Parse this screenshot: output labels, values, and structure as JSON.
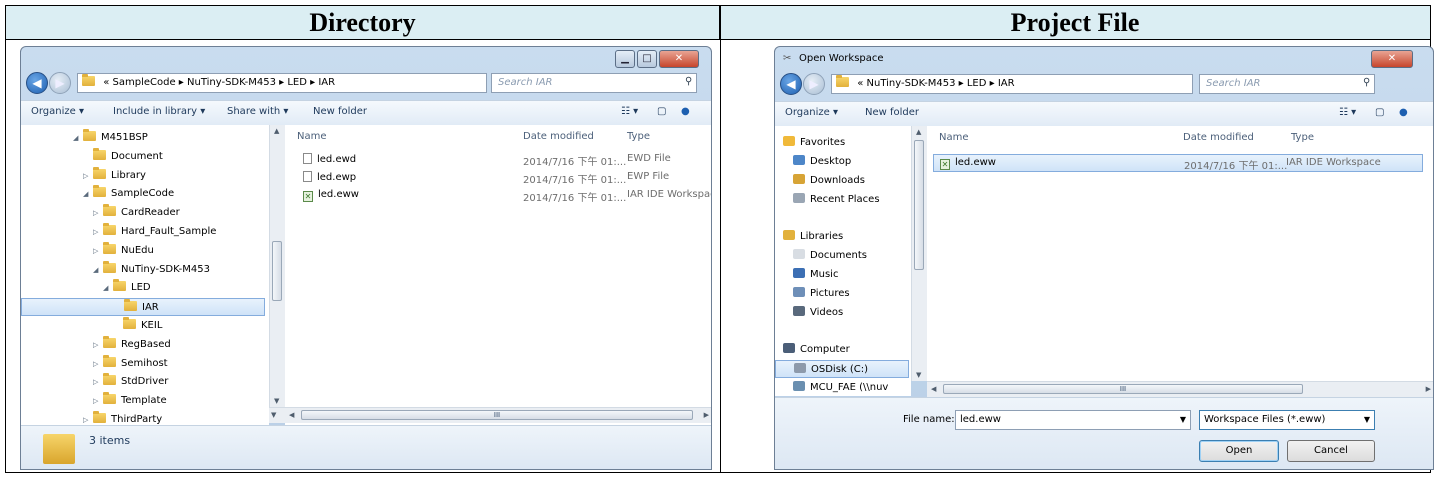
{
  "headers": {
    "left": "Directory",
    "right": "Project File"
  },
  "explorer": {
    "breadcrumb": [
      "«",
      "SampleCode",
      "NuTiny-SDK-M453",
      "LED",
      "IAR"
    ],
    "search_placeholder": "Search IAR",
    "toolbar": {
      "organize": "Organize ▾",
      "include": "Include in library ▾",
      "share": "Share with ▾",
      "new_folder": "New folder"
    },
    "tree": [
      {
        "label": "M451BSP",
        "indent": 0,
        "expander": "◢"
      },
      {
        "label": "Document",
        "indent": 1,
        "expander": ""
      },
      {
        "label": "Library",
        "indent": 1,
        "expander": "▷"
      },
      {
        "label": "SampleCode",
        "indent": 1,
        "expander": "◢"
      },
      {
        "label": "CardReader",
        "indent": 2,
        "expander": "▷"
      },
      {
        "label": "Hard_Fault_Sample",
        "indent": 2,
        "expander": "▷"
      },
      {
        "label": "NuEdu",
        "indent": 2,
        "expander": "▷"
      },
      {
        "label": "NuTiny-SDK-M453",
        "indent": 2,
        "expander": "◢"
      },
      {
        "label": "LED",
        "indent": 3,
        "expander": "◢"
      },
      {
        "label": "IAR",
        "indent": 4,
        "expander": ""
      },
      {
        "label": "KEIL",
        "indent": 4,
        "expander": ""
      },
      {
        "label": "RegBased",
        "indent": 2,
        "expander": "▷"
      },
      {
        "label": "Semihost",
        "indent": 2,
        "expander": "▷"
      },
      {
        "label": "StdDriver",
        "indent": 2,
        "expander": "▷"
      },
      {
        "label": "Template",
        "indent": 2,
        "expander": "▷"
      },
      {
        "label": "ThirdParty",
        "indent": 1,
        "expander": "▷"
      }
    ],
    "columns": {
      "name": "Name",
      "date": "Date modified",
      "type": "Type"
    },
    "files": [
      {
        "name": "led.ewd",
        "date": "2014/7/16 下午 01:...",
        "type": "EWD File",
        "icon": "file-icon"
      },
      {
        "name": "led.ewp",
        "date": "2014/7/16 下午 01:...",
        "type": "EWP File",
        "icon": "file-icon"
      },
      {
        "name": "led.eww",
        "date": "2014/7/16 下午 01:...",
        "type": "IAR IDE Workspace",
        "icon": "workspace-icon"
      }
    ],
    "status_text": "3 items",
    "scroll_arrow_h": "III"
  },
  "dialog": {
    "title": "Open Workspace",
    "breadcrumb": [
      "«",
      "NuTiny-SDK-M453",
      "LED",
      "IAR"
    ],
    "search_placeholder": "Search IAR",
    "toolbar": {
      "organize": "Organize ▾",
      "new_folder": "New folder"
    },
    "nav": [
      {
        "label": "Favorites",
        "icon": "star-icon",
        "group": true
      },
      {
        "label": "Desktop",
        "icon": "desktop-icon"
      },
      {
        "label": "Downloads",
        "icon": "downloads-icon"
      },
      {
        "label": "Recent Places",
        "icon": "recent-places-icon"
      },
      {
        "label": "Libraries",
        "icon": "libraries-icon",
        "group": true
      },
      {
        "label": "Documents",
        "icon": "documents-icon"
      },
      {
        "label": "Music",
        "icon": "music-icon"
      },
      {
        "label": "Pictures",
        "icon": "pictures-icon"
      },
      {
        "label": "Videos",
        "icon": "videos-icon"
      },
      {
        "label": "Computer",
        "icon": "computer-icon",
        "group": true
      },
      {
        "label": "OSDisk (C:)",
        "icon": "disk-icon"
      },
      {
        "label": "MCU_FAE (\\\\nuv",
        "icon": "network-drive-icon"
      }
    ],
    "columns": {
      "name": "Name",
      "date": "Date modified",
      "type": "Type"
    },
    "files": [
      {
        "name": "led.eww",
        "date": "2014/7/16 下午 01:...",
        "type": "IAR IDE Workspace"
      }
    ],
    "filename_label": "File name:",
    "filename_value": "led.eww",
    "filetype_value": "Workspace Files (*.eww)",
    "open_label": "Open",
    "cancel_label": "Cancel",
    "scroll_arrow_h": "III"
  }
}
